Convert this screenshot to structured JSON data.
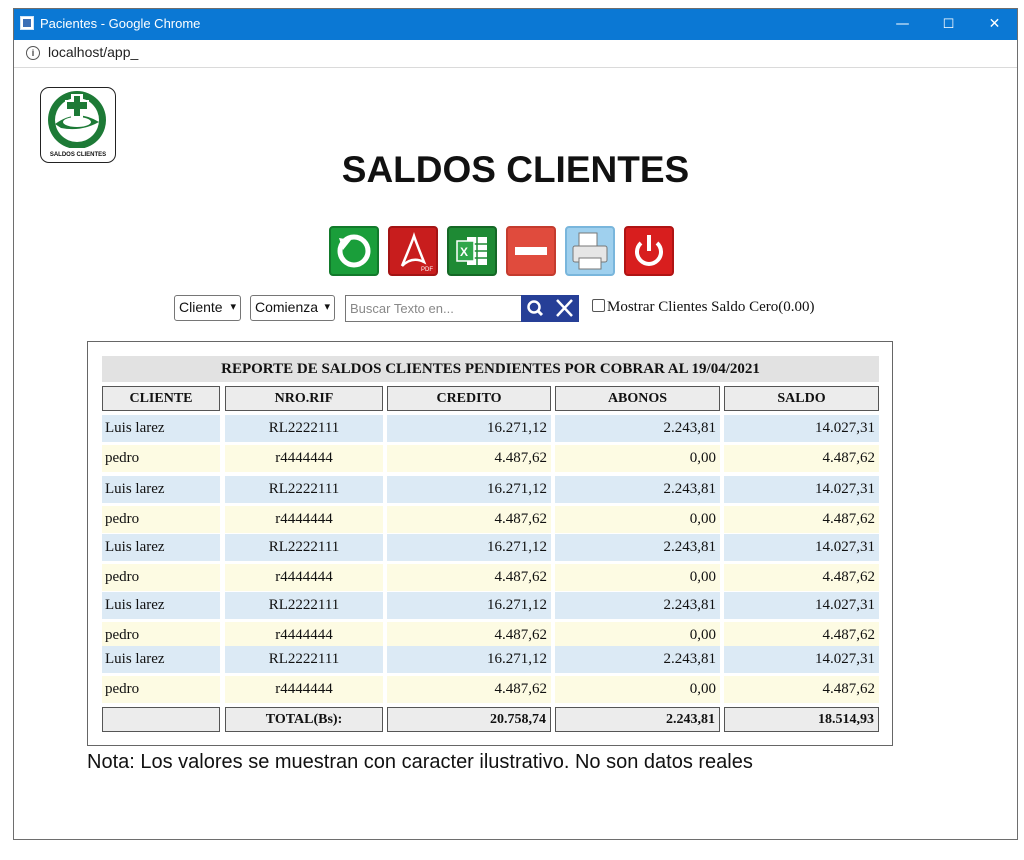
{
  "browser": {
    "window_title": "Pacientes - Google Chrome",
    "url": "localhost/app_",
    "minimize": "—",
    "maximize": "☐",
    "close": "✕"
  },
  "logo": {
    "caption": "SALDOS CLIENTES"
  },
  "page": {
    "title": "SALDOS CLIENTES"
  },
  "toolbar": {
    "buttons": [
      {
        "icon": "refresh-icon",
        "color": "#1a9e3a"
      },
      {
        "icon": "pdf-icon",
        "color": "#c81d1d"
      },
      {
        "icon": "excel-icon",
        "color": "#1e8a34"
      },
      {
        "icon": "minus-icon",
        "color": "#e04b3d"
      },
      {
        "icon": "printer-icon",
        "color": "#8fc6e8"
      },
      {
        "icon": "power-icon",
        "color": "#d81e1e"
      }
    ]
  },
  "filters": {
    "field_select": "Cliente",
    "mode_select": "Comienza",
    "search_placeholder": "Buscar Texto en...",
    "zero_balance_label": "Mostrar Clientes Saldo Cero(0.00)"
  },
  "report": {
    "title": "REPORTE DE SALDOS CLIENTES PENDIENTES POR COBRAR AL 19/04/2021",
    "columns": [
      "CLIENTE",
      "NRO.RIF",
      "CREDITO",
      "ABONOS",
      "SALDO"
    ],
    "rows": [
      [
        "Luis larez",
        "RL2222111",
        "16.271,12",
        "2.243,81",
        "14.027,31"
      ],
      [
        "pedro",
        "r4444444",
        "4.487,62",
        "0,00",
        "4.487,62"
      ],
      [
        "Luis larez",
        "RL2222111",
        "16.271,12",
        "2.243,81",
        "14.027,31"
      ],
      [
        "pedro",
        "r4444444",
        "4.487,62",
        "0,00",
        "4.487,62"
      ],
      [
        "Luis larez",
        "RL2222111",
        "16.271,12",
        "2.243,81",
        "14.027,31"
      ],
      [
        "pedro",
        "r4444444",
        "4.487,62",
        "0,00",
        "4.487,62"
      ],
      [
        "Luis larez",
        "RL2222111",
        "16.271,12",
        "2.243,81",
        "14.027,31"
      ],
      [
        "pedro",
        "r4444444",
        "4.487,62",
        "0,00",
        "4.487,62"
      ],
      [
        "Luis larez",
        "RL2222111",
        "16.271,12",
        "2.243,81",
        "14.027,31"
      ],
      [
        "pedro",
        "r4444444",
        "4.487,62",
        "0,00",
        "4.487,62"
      ]
    ],
    "totals": {
      "label": "TOTAL(Bs):",
      "credito": "20.758,74",
      "abonos": "2.243,81",
      "saldo": "18.514,93"
    },
    "row_colors": [
      "#dceaf5",
      "#fdfbe3"
    ]
  },
  "note": "Nota: Los valores se muestran con caracter ilustrativo. No son datos reales"
}
